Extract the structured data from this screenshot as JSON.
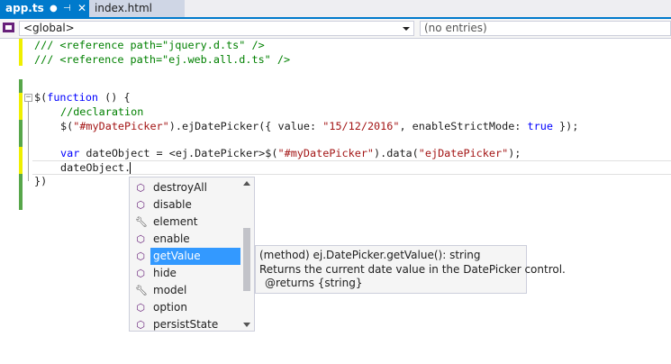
{
  "tabs": [
    {
      "label": "app.ts",
      "modified_dot": "●",
      "pin": "⊣",
      "close": "✕",
      "active": true
    },
    {
      "label": "index.html",
      "active": false
    }
  ],
  "navbar": {
    "scope": "<global>",
    "member": "(no entries)"
  },
  "code": {
    "line1": "/// <reference path=\"jquery.d.ts\" />",
    "line2": "/// <reference path=\"ej.web.all.d.ts\" />",
    "line4_a": "$(",
    "line4_kw": "function",
    "line4_b": " () {",
    "line5": "//declaration",
    "line6_a": "$(",
    "line6_s": "\"#myDatePicker\"",
    "line6_b": ").ejDatePicker({ value: ",
    "line6_s2": "\"15/12/2016\"",
    "line6_c": ", enableStrictMode: ",
    "line6_kw": "true",
    "line6_d": " });",
    "line8_kw": "var",
    "line8_a": " dateObject = <ej.DatePicker>$(",
    "line8_s": "\"#myDatePicker\"",
    "line8_b": ").data(",
    "line8_s2": "\"ejDatePicker\"",
    "line8_c": ");",
    "line9": "dateObject.",
    "line10": "})"
  },
  "completion": {
    "items": [
      {
        "label": "destroyAll",
        "icon": "method-icon"
      },
      {
        "label": "disable",
        "icon": "method-icon"
      },
      {
        "label": "element",
        "icon": "wrench-icon"
      },
      {
        "label": "enable",
        "icon": "method-icon"
      },
      {
        "label": "getValue",
        "icon": "method-icon",
        "selected": true
      },
      {
        "label": "hide",
        "icon": "method-icon"
      },
      {
        "label": "model",
        "icon": "wrench-icon"
      },
      {
        "label": "option",
        "icon": "method-icon"
      },
      {
        "label": "persistState",
        "icon": "method-icon"
      }
    ]
  },
  "tooltip": {
    "signature": "(method) ej.DatePicker.getValue(): string",
    "description": "Returns the current date value in the DatePicker control.",
    "returns": "@returns {string}"
  },
  "colors": {
    "accent": "#007acc",
    "selection": "#3399ff",
    "margin_green": "#57a64a",
    "margin_yellow": "#efef00"
  }
}
